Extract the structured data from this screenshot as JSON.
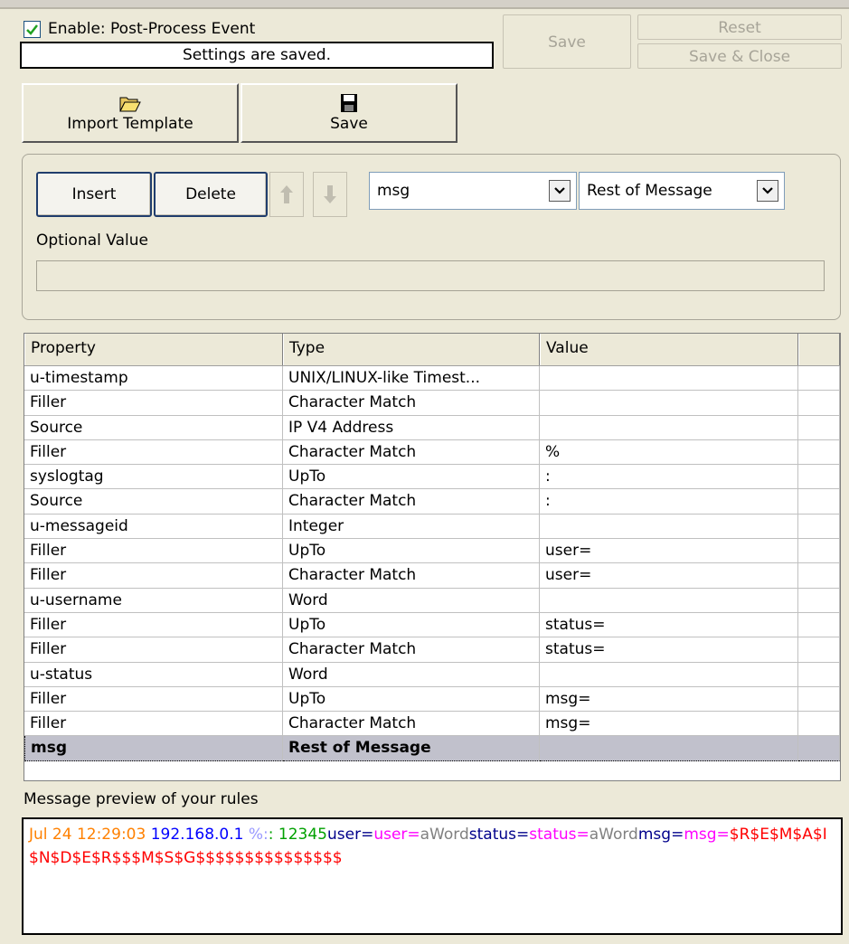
{
  "header": {
    "enable_label": "Enable: Post-Process Event",
    "enable_checked": true,
    "status": "Settings are saved.",
    "save_label": "Save",
    "reset_label": "Reset",
    "save_close_label": "Save & Close"
  },
  "toolbar": {
    "import_label": "Import Template",
    "save_label": "Save"
  },
  "editor": {
    "insert_label": "Insert",
    "delete_label": "Delete",
    "property_value": "msg",
    "type_value": "Rest of Message",
    "optional_label": "Optional Value",
    "optional_value": ""
  },
  "table": {
    "columns": [
      "Property",
      "Type",
      "Value"
    ],
    "rows": [
      {
        "property": "u-timestamp",
        "type": "UNIX/LINUX-like Timest...",
        "value": ""
      },
      {
        "property": "Filler",
        "type": "Character Match",
        "value": ""
      },
      {
        "property": "Source",
        "type": "IP V4 Address",
        "value": ""
      },
      {
        "property": "Filler",
        "type": "Character Match",
        "value": "%"
      },
      {
        "property": "syslogtag",
        "type": "UpTo",
        "value": ":"
      },
      {
        "property": "Source",
        "type": "Character Match",
        "value": ":"
      },
      {
        "property": "u-messageid",
        "type": "Integer",
        "value": ""
      },
      {
        "property": "Filler",
        "type": "UpTo",
        "value": "user="
      },
      {
        "property": "Filler",
        "type": "Character Match",
        "value": "user="
      },
      {
        "property": "u-username",
        "type": "Word",
        "value": ""
      },
      {
        "property": "Filler",
        "type": "UpTo",
        "value": "status="
      },
      {
        "property": "Filler",
        "type": "Character Match",
        "value": "status="
      },
      {
        "property": "u-status",
        "type": "Word",
        "value": ""
      },
      {
        "property": "Filler",
        "type": "UpTo",
        "value": "msg="
      },
      {
        "property": "Filler",
        "type": "Character Match",
        "value": "msg="
      },
      {
        "property": "msg",
        "type": "Rest of Message",
        "value": ""
      }
    ],
    "selected_index": 15
  },
  "preview": {
    "label": "Message preview of your rules",
    "segments": [
      {
        "text": "Jul 24 12:29:03 ",
        "color": "#ff8000"
      },
      {
        "text": "192.168.0.1 ",
        "color": "#0000ff"
      },
      {
        "text": "%:",
        "color": "#9999ff"
      },
      {
        "text": ": 12345",
        "color": "#00a000"
      },
      {
        "text": "user=",
        "color": "#00008b"
      },
      {
        "text": "user=",
        "color": "#ff00ff"
      },
      {
        "text": "aWord",
        "color": "#808080"
      },
      {
        "text": "status=",
        "color": "#00008b"
      },
      {
        "text": "status=",
        "color": "#ff00ff"
      },
      {
        "text": "aWord",
        "color": "#808080"
      },
      {
        "text": "msg=",
        "color": "#00008b"
      },
      {
        "text": "msg=",
        "color": "#ff00ff"
      },
      {
        "text": "$R$E$M$A$I$N$D$E$R$$$M$S$G$$$$$$$$$$$$$$$",
        "color": "#ff0000"
      }
    ]
  }
}
